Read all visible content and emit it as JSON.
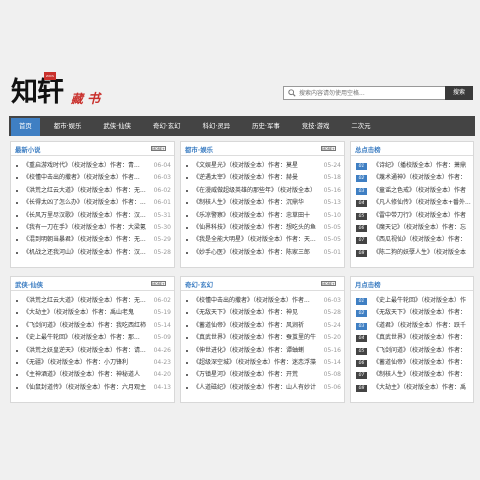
{
  "logo": {
    "zhi": "知轩",
    "seal": "ZXCS",
    "cang": "藏",
    "shu": "书"
  },
  "search": {
    "placeholder": "搜索内容请勿使用空格...",
    "button": "搜索"
  },
  "nav": [
    "首页",
    "都市·娱乐",
    "武侠·仙侠",
    "奇幻·玄幻",
    "科幻·灵异",
    "历史·军事",
    "竞技·游戏",
    "二次元"
  ],
  "more_label": "MORE+",
  "panels": [
    {
      "title": "最新小说",
      "items": [
        {
          "t": "《重启游戏时代》（校对版全本）作者：青...",
          "d": "06-04"
        },
        {
          "t": "《校懂中击出的撒者》（校对版全本）作者...",
          "d": "06-03"
        },
        {
          "t": "《洪荒之红云大道》（校对版全本）作者：无...",
          "d": "06-02"
        },
        {
          "t": "《长得太凶了怎么办》（校对版全本）作者：...",
          "d": "06-01"
        },
        {
          "t": "《长风万里尽汉歌》（校对版全本）作者：汉...",
          "d": "05-31"
        },
        {
          "t": "《我有一刀在手》（校对版全本）作者：大梁氪",
          "d": "05-30"
        },
        {
          "t": "《混到明朝当暴君》（校对版全本）作者：无...",
          "d": "05-29"
        },
        {
          "t": "《机战之还我河山》（校对版全本）作者：汉...",
          "d": "05-28"
        }
      ]
    },
    {
      "title": "都市·娱乐",
      "items": [
        {
          "t": "《文娱星光》（校对版全本）作者：莫星",
          "d": "05-24"
        },
        {
          "t": "《逆遇太宰》（校对版全本）作者：赫曼",
          "d": "05-18"
        },
        {
          "t": "《在漫威做超级英雄的那些年》（校对版全本）",
          "d": "05-16"
        },
        {
          "t": "《制核人生》（校对版全本）作者：沉鼎华",
          "d": "05-13"
        },
        {
          "t": "《乐凉警察》（校对版全本）作者：忠草田十",
          "d": "05-10"
        },
        {
          "t": "《仙界科技》（校对版全本）作者：想吃头的鱼",
          "d": "05-05"
        },
        {
          "t": "《我是全能大明星》（校对版全本）作者：天...",
          "d": "05-05"
        },
        {
          "t": "《妙手心医》（校对版全本）作者：陈家三郎",
          "d": "05-01"
        }
      ]
    },
    {
      "title": "武侠·仙侠",
      "items": [
        {
          "t": "《洪荒之红云大道》（校对版全本）作者：无...",
          "d": "06-02"
        },
        {
          "t": "《大劫主》（校对版全本）作者：禹山老鬼",
          "d": "05-19"
        },
        {
          "t": "《飞剑问道》（校对版全本）作者：我吃西红柿",
          "d": "05-14"
        },
        {
          "t": "《史上最牛轮回》（校对版全本）作者：那...",
          "d": "05-09"
        },
        {
          "t": "《洪荒之妖皇逆天》（校对版全本）作者：请...",
          "d": "04-26"
        },
        {
          "t": "《无疆》（校对版全本）作者：小刀锋利",
          "d": "04-23"
        },
        {
          "t": "《主神酒道》（校对版全本）作者：神秘道人",
          "d": "04-20"
        },
        {
          "t": "《仙鼠封道传》（校对版全本）作者：六月观主",
          "d": "04-13"
        }
      ]
    },
    {
      "title": "奇幻·玄幻",
      "items": [
        {
          "t": "《校懂中击出的撒者》（校对版全本）作者...",
          "d": "06-03"
        },
        {
          "t": "《无敌天下》（校对版全本）作者：神见",
          "d": "05-28"
        },
        {
          "t": "《蓄道仙帝》（校对版全本）作者：风涧祈",
          "d": "05-24"
        },
        {
          "t": "《真武世界》（校对版全本）作者：蚕茧里的牛",
          "d": "05-20"
        },
        {
          "t": "《伸世进化》（校对版全本）作者：谭蚰蝲",
          "d": "05-16"
        },
        {
          "t": "《超级深空城》（校对版全本）作者：迷恋浮藻",
          "d": "05-14"
        },
        {
          "t": "《万镇星河》（校对版全本）作者：开荒",
          "d": "05-08"
        },
        {
          "t": "《人道磁纪》（校对版全本）作者：山人有妙计",
          "d": "05-06"
        }
      ]
    }
  ],
  "ranks": [
    {
      "title": "总点击榜",
      "items": [
        "《诗纪》（播校版全本）作者：萧鼎",
        "《蔑术通神》（校对版全本）作者：",
        "《童谣之色戒》（校对版全本）作者",
        "《凡人修仙传》（校对版全本+番外...",
        "《雷中带刀行》（校对版全本）作者",
        "《魔天记》（校对版全本）作者：忘",
        "《西瓜视仙》（校对版全本）作者：",
        "《陈二狗的妖孽人生》（校对版全本"
      ]
    },
    {
      "title": "月点击榜",
      "items": [
        "《史上最牛轮回》（校对版全本）作",
        "《无敌天下》（校对版全本）作者：",
        "《道君》（校对版全本）作者：跃千",
        "《真武世界》（校对版全本）作者：",
        "《飞剑问道》（校对版全本）作者：",
        "《蓄道仙帝》（校对版全本）作者：",
        "《制核人生》（校对版全本）作者：",
        "《大劫主》（校对版全本）作者：禹"
      ]
    }
  ]
}
